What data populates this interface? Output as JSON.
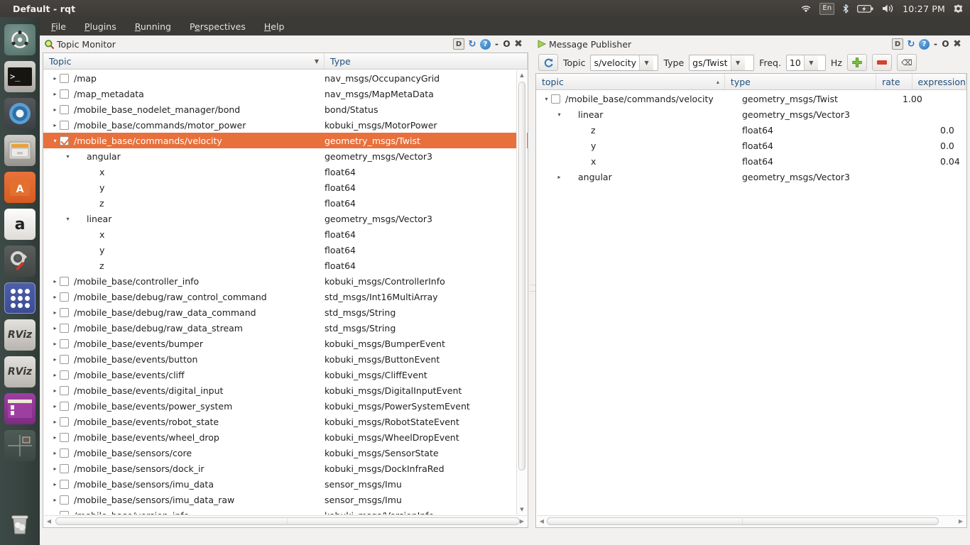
{
  "window": {
    "title": "Default - rqt"
  },
  "system_tray": {
    "items": [
      {
        "name": "wifi-icon",
        "label": ""
      },
      {
        "name": "keyboard-layout-indicator",
        "label": "En"
      },
      {
        "name": "bluetooth-icon",
        "label": ""
      },
      {
        "name": "battery-icon",
        "label": ""
      },
      {
        "name": "volume-icon",
        "label": ""
      },
      {
        "name": "clock",
        "label": "10:27 PM"
      },
      {
        "name": "session-gear-icon",
        "label": ""
      }
    ],
    "clock": "10:27 PM",
    "keyboard": "En"
  },
  "menubar": {
    "items": [
      {
        "label": "File",
        "mnemonic": "F"
      },
      {
        "label": "Plugins",
        "mnemonic": "P"
      },
      {
        "label": "Running",
        "mnemonic": "R"
      },
      {
        "label": "Perspectives",
        "mnemonic": "e"
      },
      {
        "label": "Help",
        "mnemonic": "H"
      }
    ]
  },
  "launcher": {
    "items": [
      {
        "name": "ubuntu-dash-icon",
        "label": ""
      },
      {
        "name": "terminal-icon",
        "label": ">_"
      },
      {
        "name": "chromium-icon",
        "label": ""
      },
      {
        "name": "files-icon",
        "label": ""
      },
      {
        "name": "ubuntu-software-icon",
        "label": "A"
      },
      {
        "name": "amazon-icon",
        "label": "a"
      },
      {
        "name": "system-settings-icon",
        "label": ""
      },
      {
        "name": "apps-grid-icon",
        "label": ""
      },
      {
        "name": "rviz-icon-1",
        "label": "RViz"
      },
      {
        "name": "rviz-icon-2",
        "label": "RViz"
      },
      {
        "name": "rqt-icon",
        "label": ""
      },
      {
        "name": "workspace-switcher-icon",
        "label": ""
      },
      {
        "name": "trash-icon",
        "label": ""
      }
    ]
  },
  "dock_buttons": {
    "d": "D",
    "reload": "↻",
    "help": "?",
    "minimize": "-",
    "float": "O",
    "close": "✖"
  },
  "topic_monitor": {
    "title": "Topic Monitor",
    "columns": [
      {
        "label": "Topic",
        "sort": "▼"
      },
      {
        "label": "Type"
      }
    ],
    "rows": [
      {
        "indent": 0,
        "arrow": "▸",
        "checkbox": "unchecked",
        "topic": "/map",
        "type": "nav_msgs/OccupancyGrid",
        "selected": false
      },
      {
        "indent": 0,
        "arrow": "▸",
        "checkbox": "unchecked",
        "topic": "/map_metadata",
        "type": "nav_msgs/MapMetaData",
        "selected": false
      },
      {
        "indent": 0,
        "arrow": "▸",
        "checkbox": "unchecked",
        "topic": "/mobile_base_nodelet_manager/bond",
        "type": "bond/Status",
        "selected": false
      },
      {
        "indent": 0,
        "arrow": "▸",
        "checkbox": "unchecked",
        "topic": "/mobile_base/commands/motor_power",
        "type": "kobuki_msgs/MotorPower",
        "selected": false
      },
      {
        "indent": 0,
        "arrow": "▾",
        "checkbox": "checked",
        "topic": "/mobile_base/commands/velocity",
        "type": "geometry_msgs/Twist",
        "selected": true
      },
      {
        "indent": 1,
        "arrow": "▾",
        "checkbox": "none",
        "topic": "angular",
        "type": "geometry_msgs/Vector3",
        "selected": false
      },
      {
        "indent": 2,
        "arrow": "",
        "checkbox": "none",
        "topic": "x",
        "type": "float64",
        "selected": false
      },
      {
        "indent": 2,
        "arrow": "",
        "checkbox": "none",
        "topic": "y",
        "type": "float64",
        "selected": false
      },
      {
        "indent": 2,
        "arrow": "",
        "checkbox": "none",
        "topic": "z",
        "type": "float64",
        "selected": false
      },
      {
        "indent": 1,
        "arrow": "▾",
        "checkbox": "none",
        "topic": "linear",
        "type": "geometry_msgs/Vector3",
        "selected": false
      },
      {
        "indent": 2,
        "arrow": "",
        "checkbox": "none",
        "topic": "x",
        "type": "float64",
        "selected": false
      },
      {
        "indent": 2,
        "arrow": "",
        "checkbox": "none",
        "topic": "y",
        "type": "float64",
        "selected": false
      },
      {
        "indent": 2,
        "arrow": "",
        "checkbox": "none",
        "topic": "z",
        "type": "float64",
        "selected": false
      },
      {
        "indent": 0,
        "arrow": "▸",
        "checkbox": "unchecked",
        "topic": "/mobile_base/controller_info",
        "type": "kobuki_msgs/ControllerInfo",
        "selected": false
      },
      {
        "indent": 0,
        "arrow": "▸",
        "checkbox": "unchecked",
        "topic": "/mobile_base/debug/raw_control_command",
        "type": "std_msgs/Int16MultiArray",
        "selected": false
      },
      {
        "indent": 0,
        "arrow": "▸",
        "checkbox": "unchecked",
        "topic": "/mobile_base/debug/raw_data_command",
        "type": "std_msgs/String",
        "selected": false
      },
      {
        "indent": 0,
        "arrow": "▸",
        "checkbox": "unchecked",
        "topic": "/mobile_base/debug/raw_data_stream",
        "type": "std_msgs/String",
        "selected": false
      },
      {
        "indent": 0,
        "arrow": "▸",
        "checkbox": "unchecked",
        "topic": "/mobile_base/events/bumper",
        "type": "kobuki_msgs/BumperEvent",
        "selected": false
      },
      {
        "indent": 0,
        "arrow": "▸",
        "checkbox": "unchecked",
        "topic": "/mobile_base/events/button",
        "type": "kobuki_msgs/ButtonEvent",
        "selected": false
      },
      {
        "indent": 0,
        "arrow": "▸",
        "checkbox": "unchecked",
        "topic": "/mobile_base/events/cliff",
        "type": "kobuki_msgs/CliffEvent",
        "selected": false
      },
      {
        "indent": 0,
        "arrow": "▸",
        "checkbox": "unchecked",
        "topic": "/mobile_base/events/digital_input",
        "type": "kobuki_msgs/DigitalInputEvent",
        "selected": false
      },
      {
        "indent": 0,
        "arrow": "▸",
        "checkbox": "unchecked",
        "topic": "/mobile_base/events/power_system",
        "type": "kobuki_msgs/PowerSystemEvent",
        "selected": false
      },
      {
        "indent": 0,
        "arrow": "▸",
        "checkbox": "unchecked",
        "topic": "/mobile_base/events/robot_state",
        "type": "kobuki_msgs/RobotStateEvent",
        "selected": false
      },
      {
        "indent": 0,
        "arrow": "▸",
        "checkbox": "unchecked",
        "topic": "/mobile_base/events/wheel_drop",
        "type": "kobuki_msgs/WheelDropEvent",
        "selected": false
      },
      {
        "indent": 0,
        "arrow": "▸",
        "checkbox": "unchecked",
        "topic": "/mobile_base/sensors/core",
        "type": "kobuki_msgs/SensorState",
        "selected": false
      },
      {
        "indent": 0,
        "arrow": "▸",
        "checkbox": "unchecked",
        "topic": "/mobile_base/sensors/dock_ir",
        "type": "kobuki_msgs/DockInfraRed",
        "selected": false
      },
      {
        "indent": 0,
        "arrow": "▸",
        "checkbox": "unchecked",
        "topic": "/mobile_base/sensors/imu_data",
        "type": "sensor_msgs/Imu",
        "selected": false
      },
      {
        "indent": 0,
        "arrow": "▸",
        "checkbox": "unchecked",
        "topic": "/mobile_base/sensors/imu_data_raw",
        "type": "sensor_msgs/Imu",
        "selected": false
      },
      {
        "indent": 0,
        "arrow": "▸",
        "checkbox": "unchecked",
        "topic": "/mobile_base/version_info",
        "type": "kobuki_msgs/VersionInfo",
        "selected": false
      }
    ]
  },
  "message_publisher": {
    "title": "Message Publisher",
    "toolbar": {
      "refresh_icon": "↻",
      "topic_label": "Topic",
      "topic_value": "s/velocity",
      "type_label": "Type",
      "type_value": "gs/Twist",
      "freq_label": "Freq.",
      "freq_value": "10",
      "hz_label": "Hz",
      "add_label": "+",
      "remove_label": "–",
      "clear_label": "⌫"
    },
    "columns": [
      {
        "label": "topic",
        "sort": "▴"
      },
      {
        "label": "type"
      },
      {
        "label": "rate"
      },
      {
        "label": "expression"
      }
    ],
    "rows": [
      {
        "indent": 0,
        "arrow": "▾",
        "checkbox": "unchecked",
        "topic": "/mobile_base/commands/velocity",
        "type": "geometry_msgs/Twist",
        "rate": "1.00",
        "expression": ""
      },
      {
        "indent": 1,
        "arrow": "▾",
        "checkbox": "none",
        "topic": "linear",
        "type": "geometry_msgs/Vector3",
        "rate": "",
        "expression": ""
      },
      {
        "indent": 2,
        "arrow": "",
        "checkbox": "none",
        "topic": "z",
        "type": "float64",
        "rate": "",
        "expression": "0.0"
      },
      {
        "indent": 2,
        "arrow": "",
        "checkbox": "none",
        "topic": "y",
        "type": "float64",
        "rate": "",
        "expression": "0.0"
      },
      {
        "indent": 2,
        "arrow": "",
        "checkbox": "none",
        "topic": "x",
        "type": "float64",
        "rate": "",
        "expression": "0.04"
      },
      {
        "indent": 1,
        "arrow": "▸",
        "checkbox": "none",
        "topic": "angular",
        "type": "geometry_msgs/Vector3",
        "rate": "",
        "expression": ""
      }
    ]
  },
  "colors": {
    "selection": "#e8703c",
    "panel_bg": "#f2f1f0",
    "header_text": "#1d4f7c",
    "top_panel": "#3b3a37",
    "launcher": "#374340"
  }
}
